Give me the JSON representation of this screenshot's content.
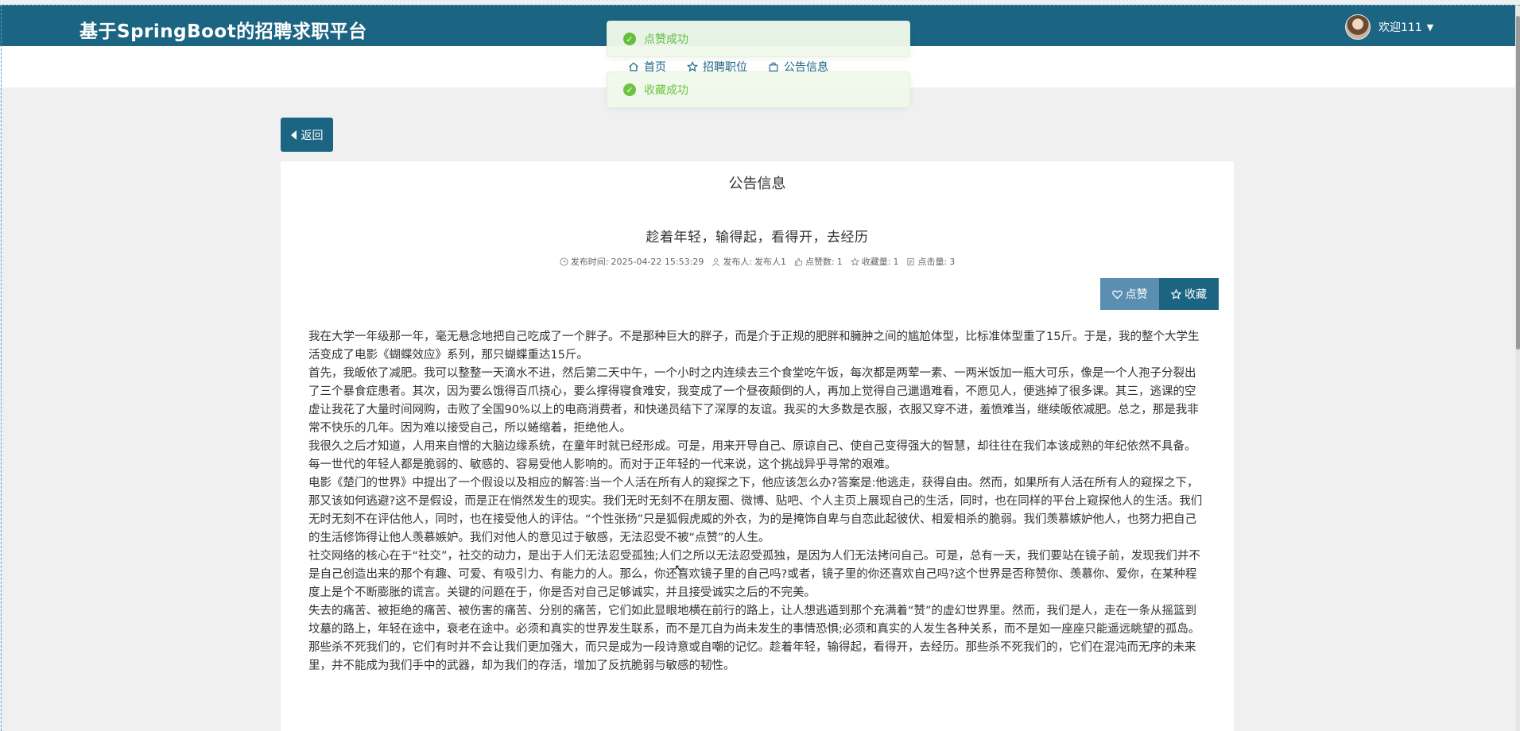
{
  "app": {
    "brand": "基于SpringBoot的招聘求职平台",
    "user_greeting": "欢迎111"
  },
  "nav": {
    "items": [
      {
        "label": "首页",
        "icon": "home-icon"
      },
      {
        "label": "招聘职位",
        "icon": "star-icon"
      },
      {
        "label": "公告信息",
        "icon": "bag-icon"
      }
    ]
  },
  "toasts": [
    {
      "text": "点赞成功",
      "type": "success"
    },
    {
      "text": "收藏成功",
      "type": "success"
    }
  ],
  "back_label": "返回",
  "section_title": "公告信息",
  "article": {
    "title": "趁着年轻，输得起，看得开，去经历",
    "meta": {
      "publish_label": "发布时间:",
      "publish_time": "2025-04-22 15:53:29",
      "author_label": "发布人:",
      "author": "发布人1",
      "likes_label": "点赞数:",
      "likes": "1",
      "favorites_label": "收藏量:",
      "favorites": "1",
      "clicks_label": "点击量:",
      "clicks": "3"
    },
    "like_label": "点赞",
    "favorite_label": "收藏",
    "paragraphs": [
      "我在大学一年级那一年，毫无悬念地把自己吃成了一个胖子。不是那种巨大的胖子，而是介于正规的肥胖和臃肿之间的尴尬体型，比标准体型重了15斤。于是，我的整个大学生活变成了电影《蝴蝶效应》系列，那只蝴蝶重达15斤。",
      "  首先，我皈依了减肥。我可以整整一天滴水不进，然后第二天中午，一个小时之内连续去三个食堂吃午饭，每次都是两荤一素、一两米饭加一瓶大可乐，像是一个人孢子分裂出了三个暴食症患者。其次，因为要么饿得百爪挠心，要么撑得寝食难安，我变成了一个昼夜颠倒的人，再加上觉得自己邋遢难看，不愿见人，便逃掉了很多课。其三，逃课的空虚让我花了大量时间网购，击败了全国90%以上的电商消费者，和快递员结下了深厚的友谊。我买的大多数是衣服，衣服又穿不进，羞愤难当，继续皈依减肥。总之，那是我非常不快乐的几年。因为难以接受自己，所以蜷缩着，拒绝他人。",
      "   我很久之后才知道，人用来自憎的大脑边缘系统，在童年时就已经形成。可是，用来开导自己、原谅自己、使自己变得强大的智慧，却往往在我们本该成熟的年纪依然不具备。每一世代的年轻人都是脆弱的、敏感的、容易受他人影响的。而对于正年轻的一代来说，这个挑战异乎寻常的艰难。",
      " 电影《楚门的世界》中提出了一个假设以及相应的解答:当一个人活在所有人的窥探之下，他应该怎么办?答案是:他逃走，获得自由。然而，如果所有人活在所有人的窥探之下，那又该如何逃避?这不是假设，而是正在悄然发生的现实。我们无时无刻不在朋友圈、微博、贴吧、个人主页上展现自己的生活，同时，也在同样的平台上窥探他人的生活。我们无时无刻不在评估他人，同时，也在接受他人的评估。“个性张扬”只是狐假虎威的外衣，为的是掩饰自卑与自恋此起彼伏、相爱相杀的脆弱。我们羡慕嫉妒他人，也努力把自己的生活修饰得让他人羡慕嫉妒。我们对他人的意见过于敏感，无法忍受不被“点赞”的人生。",
      "  社交网络的核心在于“社交”，社交的动力，是出于人们无法忍受孤独;人们之所以无法忍受孤独，是因为人们无法拷问自己。可是，总有一天，我们要站在镜子前，发现我们并不是自己创造出来的那个有趣、可爱、有吸引力、有能力的人。那么，你还喜欢镜子里的自己吗?或者，镜子里的你还喜欢自己吗?这个世界是否称赞你、羡慕你、爱你，在某种程度上是个不断膨胀的谎言。关键的问题在于，你是否对自己足够诚实，并且接受诚实之后的不完美。",
      "  失去的痛苦、被拒绝的痛苦、被伤害的痛苦、分别的痛苦，它们如此显眼地横在前行的路上，让人想逃遁到那个充满着“赞”的虚幻世界里。然而，我们是人，走在一条从摇篮到坟墓的路上，年轻在途中，衰老在途中。必须和真实的世界发生联系，而不是兀自为尚未发生的事情恐惧;必须和真实的人发生各种关系，而不是如一座座只能遥远眺望的孤岛。",
      "那些杀不死我们的，它们有时并不会让我们更加强大，而只是成为一段诗意或自嘲的记忆。趁着年轻，输得起，看得开，去经历。那些杀不死我们的，它们在混沌而无序的未来里，并不能成为我们手中的武器，却为我们的存活，增加了反抗脆弱与敏感的韧性。"
    ]
  },
  "colors": {
    "primary": "#1b6582",
    "like_button": "#5b8fb2",
    "toast_bg": "#f0f9eb",
    "toast_text": "#67c23a",
    "page_bg": "#f0f0f0"
  }
}
